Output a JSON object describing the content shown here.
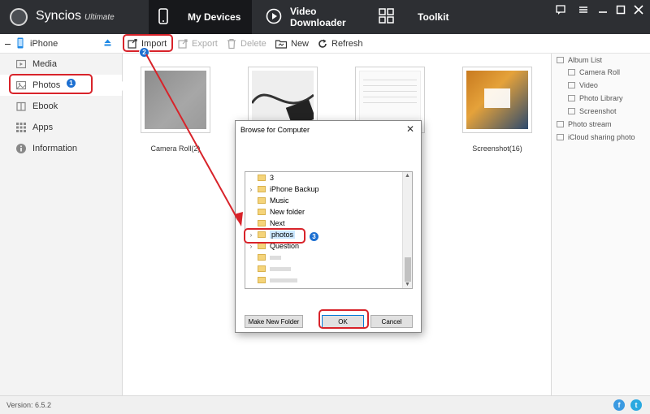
{
  "app": {
    "brand": "Syncios",
    "edition": "Ultimate"
  },
  "nav": {
    "my_devices": "My Devices",
    "video_downloader": "Video Downloader",
    "toolkit": "Toolkit"
  },
  "toolbar": {
    "device": "iPhone",
    "import": "Import",
    "export": "Export",
    "delete": "Delete",
    "new": "New",
    "refresh": "Refresh"
  },
  "sidebar": {
    "items": [
      {
        "label": "Media",
        "icon": "media-icon"
      },
      {
        "label": "Photos",
        "icon": "photos-icon"
      },
      {
        "label": "Ebook",
        "icon": "ebook-icon"
      },
      {
        "label": "Apps",
        "icon": "apps-icon"
      },
      {
        "label": "Information",
        "icon": "information-icon"
      }
    ]
  },
  "albums": [
    {
      "caption": "Camera Roll(2)"
    },
    {
      "caption": ""
    },
    {
      "caption": ""
    },
    {
      "caption": "Screenshot(16)"
    }
  ],
  "album_list": {
    "title": "Album List",
    "items": [
      "Camera Roll",
      "Video",
      "Photo Library",
      "Screenshot"
    ],
    "photo_stream": "Photo stream",
    "icloud": "iCloud sharing photo"
  },
  "dialog": {
    "title": "Browse for Computer",
    "folders": [
      "3",
      "iPhone Backup",
      "Music",
      "New folder",
      "Next",
      "photos",
      "Question",
      "",
      "",
      "",
      "",
      ""
    ],
    "make_new_folder": "Make New Folder",
    "ok": "OK",
    "cancel": "Cancel"
  },
  "status": {
    "version": "Version: 6.5.2"
  },
  "annotations": {
    "step1": "1",
    "step2": "2",
    "step3": "3"
  },
  "colors": {
    "titlebar": "#2d2f33",
    "annotation_red": "#d8232a",
    "badge_blue": "#1c6fd1",
    "facebook": "#3b9ae1",
    "twitter": "#2aa9e0"
  }
}
